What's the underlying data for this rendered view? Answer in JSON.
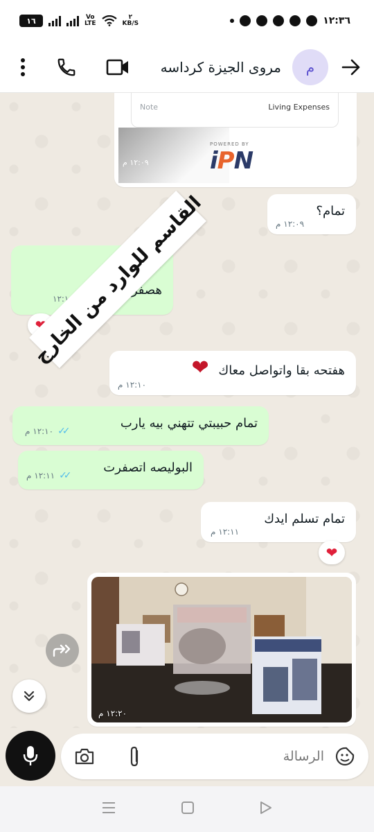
{
  "status_bar": {
    "time": "١٢:٣٦",
    "battery": "١٦",
    "network_label": "Vo",
    "network_label2": "LTE",
    "speed_value": "٢",
    "speed_unit": "KB/S"
  },
  "header": {
    "contact_name": "مروى الجيزة كرداسه",
    "avatar_letter": "م",
    "back_icon": "arrow-back-icon",
    "video_icon": "video-call-icon",
    "call_icon": "phone-icon",
    "menu_icon": "more-vert-icon"
  },
  "receipt": {
    "note_label": "Note",
    "note_value": "Living Expenses",
    "powered_by": "POWERED BY",
    "time": "١٢:٠٩ م"
  },
  "watermark": "القاسم للوارد من الخارج",
  "messages": [
    {
      "id": "m1",
      "direction": "in",
      "text": "تمام؟",
      "time": "١٢:٠٩ م"
    },
    {
      "id": "m2",
      "direction": "out",
      "line1": "تمام",
      "line2": "هصفرها حالا",
      "time": "١٢:١٠",
      "reaction": "❤"
    },
    {
      "id": "m3",
      "direction": "in",
      "text": "هفتحه بقا واتواصل معاك",
      "emoji": "❤",
      "time": "١٢:١٠ م"
    },
    {
      "id": "m4",
      "direction": "out",
      "text": "تمام حبيبتي تتهني بيه يارب",
      "time": "١٢:١٠ م",
      "status": "read"
    },
    {
      "id": "m5",
      "direction": "out",
      "text": "البوليصه اتصفرت",
      "time": "١٢:١١ م",
      "status": "read"
    },
    {
      "id": "m6",
      "direction": "in",
      "text": "تمام تسلم ايدك",
      "time": "١٢:١١ م",
      "reaction": "❤"
    }
  ],
  "photo_message": {
    "direction": "in",
    "time": "١٢:٢٠ م"
  },
  "composer": {
    "placeholder": "الرسالة",
    "emoji_icon": "sticker-icon",
    "attach_icon": "paperclip-icon",
    "camera_icon": "camera-icon",
    "mic_icon": "mic-icon"
  },
  "colors": {
    "outgoing_bubble": "#d9fdd3",
    "incoming_bubble": "#ffffff",
    "chat_background": "#efeae2",
    "read_ticks": "#53bdeb",
    "reaction_heart": "#e0203a"
  }
}
